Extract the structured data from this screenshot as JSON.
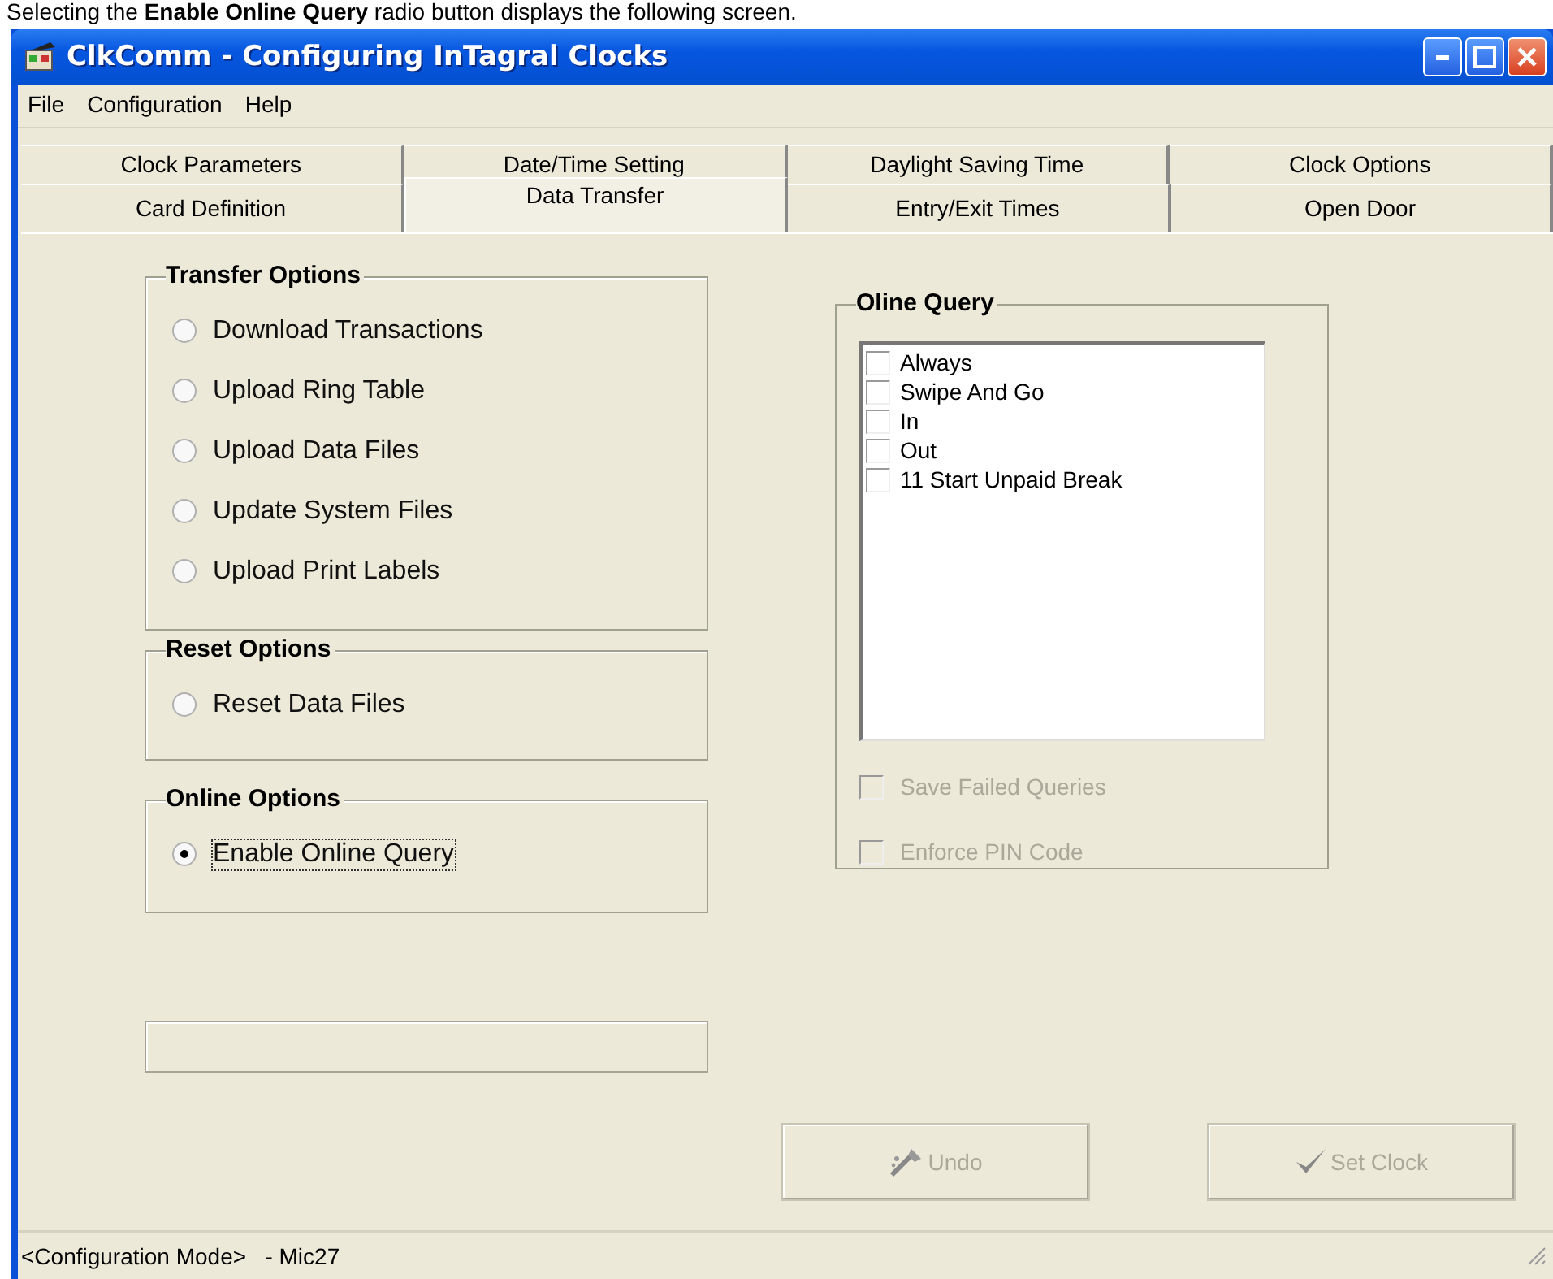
{
  "caption": "Selecting the **Enable Online Query** radio button displays the following screen.",
  "window": {
    "title": "ClkComm - Configuring InTagral Clocks"
  },
  "menu": [
    "File",
    "Configuration",
    "Help"
  ],
  "tab_rows": [
    [
      {
        "label": "Clock Parameters",
        "selected": false
      },
      {
        "label": "Date/Time Setting",
        "selected": false
      },
      {
        "label": "Daylight Saving Time",
        "selected": false
      },
      {
        "label": "Clock Options",
        "selected": false
      }
    ],
    [
      {
        "label": "Card Definition",
        "selected": false
      },
      {
        "label": "Data Transfer",
        "selected": true
      },
      {
        "label": "Entry/Exit Times",
        "selected": false
      },
      {
        "label": "Open Door",
        "selected": false
      }
    ]
  ],
  "groups": [
    {
      "title": "Transfer Options",
      "options": [
        {
          "label": "Download Transactions",
          "selected": false
        },
        {
          "label": "Upload Ring Table",
          "selected": false
        },
        {
          "label": "Upload Data Files",
          "selected": false
        },
        {
          "label": "Update System Files",
          "selected": false
        },
        {
          "label": "Upload Print Labels",
          "selected": false
        }
      ]
    },
    {
      "title": "Reset Options",
      "options": [
        {
          "label": "Reset Data Files",
          "selected": false
        }
      ]
    },
    {
      "title": "Online Options",
      "options": [
        {
          "label": "Enable Online Query",
          "selected": true
        }
      ]
    }
  ],
  "query": {
    "title": "Oline Query",
    "items": [
      {
        "label": "Always",
        "checked": false
      },
      {
        "label": "Swipe And Go",
        "checked": false
      },
      {
        "label": "In",
        "checked": false
      },
      {
        "label": "Out",
        "checked": false
      },
      {
        "label": "11 Start Unpaid Break",
        "checked": false
      }
    ],
    "options": [
      {
        "label": "Save Failed Queries",
        "checked": false,
        "disabled": true
      },
      {
        "label": "Enforce PIN Code",
        "checked": false,
        "disabled": true
      }
    ]
  },
  "buttons": [
    {
      "label": "Undo",
      "kind": "undo",
      "disabled": true
    },
    {
      "label": "Set Clock",
      "kind": "set",
      "disabled": true
    }
  ],
  "status_bar": "<Configuration Mode>   - Mic27"
}
